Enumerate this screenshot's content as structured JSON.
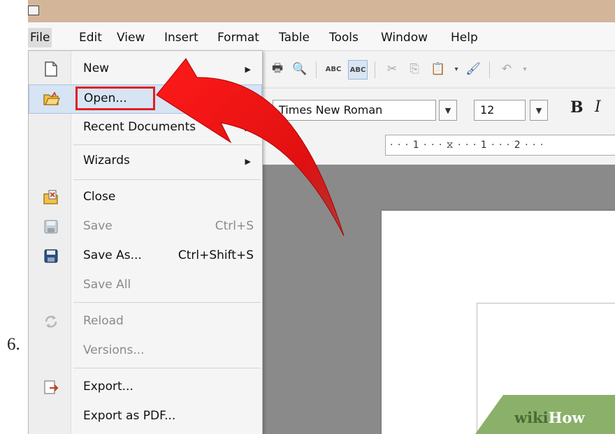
{
  "step_number": "6.",
  "menubar": {
    "items": [
      "File",
      "Edit",
      "View",
      "Insert",
      "Format",
      "Table",
      "Tools",
      "Window",
      "Help"
    ]
  },
  "toolbar": {
    "font_name": "Times New Roman",
    "font_size": "12",
    "bold_label": "B",
    "italic_label": "I",
    "ruler_text": "· · · 1 · · · ⧖ · · · 1 · · · 2 · · ·"
  },
  "file_menu": {
    "items": [
      {
        "label": "New",
        "shortcut": "",
        "submenu": true,
        "enabled": true,
        "icon": "new-document-icon"
      },
      {
        "label": "Open...",
        "shortcut": "",
        "submenu": false,
        "enabled": true,
        "icon": "open-folder-icon",
        "highlighted": true
      },
      {
        "label": "Recent Documents",
        "shortcut": "",
        "submenu": true,
        "enabled": true,
        "icon": ""
      },
      {
        "label": "Wizards",
        "shortcut": "",
        "submenu": true,
        "enabled": true,
        "icon": ""
      },
      {
        "label": "Close",
        "shortcut": "",
        "submenu": false,
        "enabled": true,
        "icon": "close-document-icon"
      },
      {
        "label": "Save",
        "shortcut": "Ctrl+S",
        "submenu": false,
        "enabled": false,
        "icon": "save-icon"
      },
      {
        "label": "Save As...",
        "shortcut": "Ctrl+Shift+S",
        "submenu": false,
        "enabled": true,
        "icon": "save-as-icon"
      },
      {
        "label": "Save All",
        "shortcut": "",
        "submenu": false,
        "enabled": false,
        "icon": ""
      },
      {
        "label": "Reload",
        "shortcut": "",
        "submenu": false,
        "enabled": false,
        "icon": "reload-icon"
      },
      {
        "label": "Versions...",
        "shortcut": "",
        "submenu": false,
        "enabled": false,
        "icon": ""
      },
      {
        "label": "Export...",
        "shortcut": "",
        "submenu": false,
        "enabled": true,
        "icon": "export-icon"
      },
      {
        "label": "Export as PDF...",
        "shortcut": "",
        "submenu": false,
        "enabled": true,
        "icon": ""
      }
    ]
  },
  "watermark": {
    "wiki": "wiki",
    "how": "How"
  },
  "colors": {
    "highlight_red": "#e02020",
    "titlebar": "#d3b59a",
    "watermark_green": "#8bb06a"
  }
}
